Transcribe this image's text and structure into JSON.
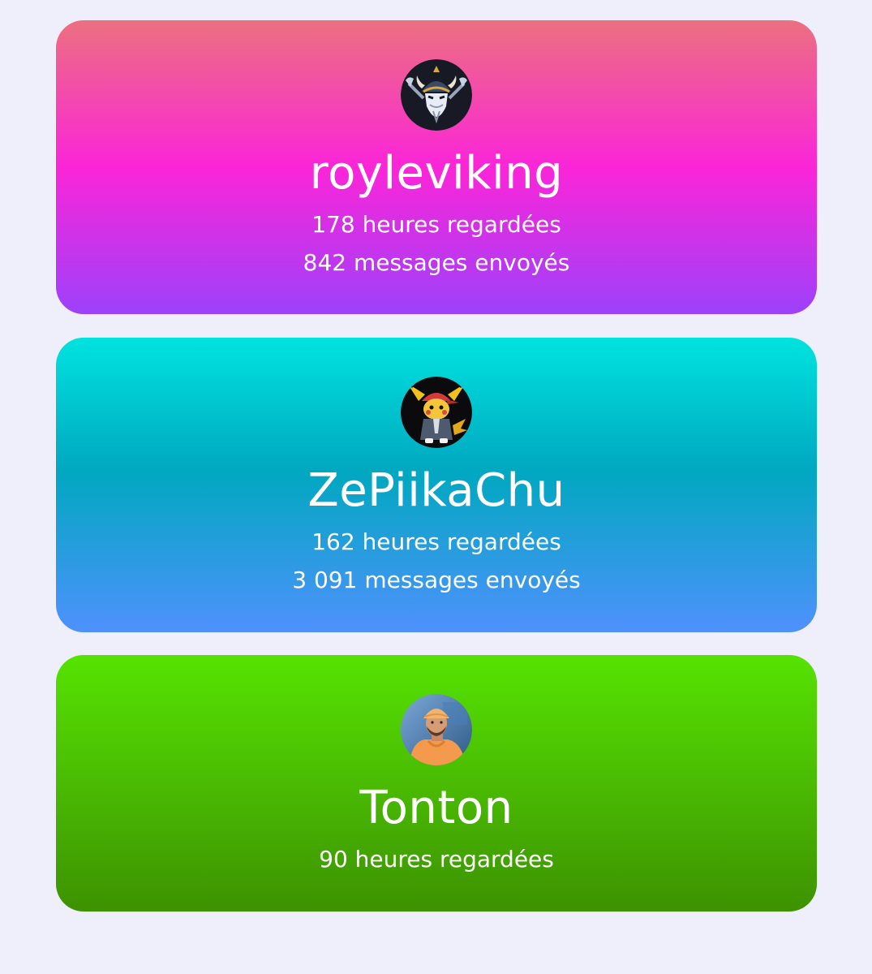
{
  "viewers": [
    {
      "username": "royleviking",
      "hours_watched": "178 heures regardées",
      "messages_sent": "842 messages envoyés",
      "avatar": "viking-warrior-icon",
      "gradient": [
        "#ec7080",
        "#fb25d8",
        "#9d41fb"
      ]
    },
    {
      "username": "ZePiikaChu",
      "hours_watched": "162 heures regardées",
      "messages_sent": "3 091 messages envoyés",
      "avatar": "cartoon-pikachu-character-icon",
      "gradient": [
        "#00e3df",
        "#00a8c0",
        "#4f91fd"
      ]
    },
    {
      "username": "Tonton",
      "hours_watched": "90 heures regardées",
      "avatar": "person-photo-avatar",
      "gradient": [
        "#56e301",
        "#4bbf03",
        "#3d9200"
      ]
    }
  ],
  "colors": {
    "page_background": "#efeffc",
    "text": "#ffffff"
  }
}
